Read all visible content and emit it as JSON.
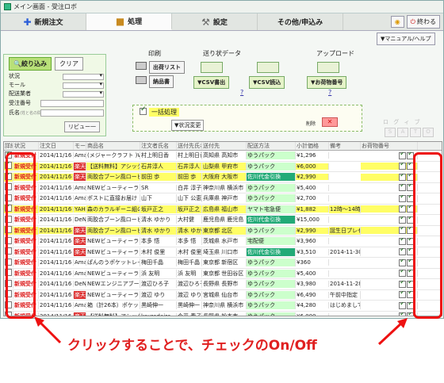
{
  "window": {
    "title": "メイン画面 - 受注ロボ"
  },
  "tabs": [
    {
      "label": "新規注文",
      "icon": "plus-icon"
    },
    {
      "label": "処理",
      "icon": "folder-icon"
    },
    {
      "label": "設定",
      "icon": "wrench-icon"
    },
    {
      "label": "その他/申込み",
      "icon": ""
    }
  ],
  "header_right": {
    "help_label": "",
    "exit_label": "終わる",
    "manual_label": "▼マニュアル/ヘルプ"
  },
  "filter": {
    "search_label": "絞り込み",
    "clear_label": "クリア",
    "fields": [
      "状況",
      "モール",
      "配送業者",
      "受注番号",
      "氏名"
    ],
    "name_hint": "(姓と名の間は空白)",
    "review_label": "リビュー一"
  },
  "sections": {
    "print": {
      "title": "印刷",
      "b1": "出荷リスト",
      "b2": "納品書"
    },
    "send": {
      "title": "送り状データ",
      "b1": "▼CSV書出",
      "b2": "▼CSV読込",
      "help": "?"
    },
    "upload": {
      "title": "アップロード",
      "b1": "▼お荷物番号",
      "help": "?"
    }
  },
  "bulk": {
    "label": "一括処理",
    "action": "▼状況変更",
    "delete": "削除"
  },
  "legend": {
    "text": "ロ グ ィ ブ",
    "boxes": [
      "S",
      "A",
      "T",
      "O"
    ]
  },
  "grid": {
    "headers": [
      "詳細",
      "状況",
      "注文日",
      "モール",
      "商品名",
      "注文者氏名",
      "送付先氏名",
      "送付先",
      "配送方法",
      "小計価格",
      "備考",
      "お荷物番号"
    ],
    "rows": [
      {
        "checked": true,
        "status": "新規受付",
        "date": "2014/11/16",
        "mall": "Ama",
        "product": "(メジャークラフト )WA",
        "orderer": "村上明日香",
        "recipient": "村上明日香",
        "dest": "高知県 高知市",
        "ship": "ゆうパック",
        "price": "¥1,296",
        "memo": "",
        "yellow": false,
        "mall_red": false,
        "ship_green": false
      },
      {
        "checked": true,
        "status": "新規受付",
        "date": "2014/11/16",
        "mall": "楽天",
        "product": "【送料無料】アシックス",
        "orderer": "石井淳人",
        "recipient": "石井淳人",
        "dest": "山梨県 甲府市",
        "ship": "ゆうパック",
        "price": "¥6,000",
        "memo": "",
        "yellow": true,
        "mall_red": true,
        "ship_green": false
      },
      {
        "checked": true,
        "status": "新規受付",
        "date": "2014/11/16",
        "mall": "楽天",
        "product": "両胶合ブーン風ローヒ",
        "orderer": "前田 歩",
        "recipient": "前田 歩",
        "dest": "大阪府 大阪市",
        "ship": "佐川代金引換",
        "price": "¥2,990",
        "memo": "",
        "yellow": true,
        "mall_red": true,
        "ship_green": true
      },
      {
        "checked": false,
        "status": "新規受付",
        "date": "2014/11/16",
        "mall": "Ama",
        "product": "NEWビューティーラッシ",
        "orderer": "SR",
        "recipient": "白井 淳子",
        "dest": "神奈川県 横浜市",
        "ship": "ゆうパック",
        "price": "¥5,400",
        "memo": "",
        "yellow": false,
        "mall_red": false,
        "ship_green": false
      },
      {
        "checked": false,
        "status": "新規受付",
        "date": "2014/11/16",
        "mall": "Ama",
        "product": "ポストに直接お届け　ボ",
        "orderer": "山下",
        "recipient": "山下 公恵",
        "dest": "兵庫県 神戸市",
        "ship": "ゆうパック",
        "price": "¥2,700",
        "memo": "",
        "yellow": false,
        "mall_red": false,
        "ship_green": false
      },
      {
        "checked": true,
        "status": "新規受付",
        "date": "2014/11/16",
        "mall": "YAH",
        "product": "森のカラルギーニ組の",
        "orderer": "坂戸正之",
        "recipient": "坂戸正之",
        "dest": "広島県 福山市",
        "ship": "ヤマト宅急便",
        "price": "¥1,882",
        "memo": "12時〜14時",
        "yellow": true,
        "mall_red": false,
        "ship_green": false
      },
      {
        "checked": false,
        "status": "新規受付",
        "date": "2014/11/16",
        "mall": "DeNa",
        "product": "両胶合ブーン風ローヒ",
        "orderer": "清水 ゆかり",
        "recipient": "大村健",
        "dest": "鹿児島県 鹿児島",
        "ship": "佐川代金引換",
        "price": "¥15,000",
        "memo": "",
        "yellow": false,
        "mall_red": false,
        "ship_green": true
      },
      {
        "checked": false,
        "status": "新規受付",
        "date": "2014/11/16",
        "mall": "楽天",
        "product": "両胶合ブーン風ローヒ",
        "orderer": "清水 ゆかり",
        "recipient": "清水 ゆかり",
        "dest": "東京都 北区",
        "ship": "ゆうパック",
        "price": "¥2,990",
        "memo": "誕生日プレゼント用に包装",
        "yellow": true,
        "mall_red": true,
        "ship_green": false
      },
      {
        "checked": false,
        "status": "新規受付",
        "date": "2014/11/16",
        "mall": "楽天",
        "product": "NEWビューティーラッシ",
        "orderer": "本多 悟",
        "recipient": "本多 悟",
        "dest": "茨城県 水戸市",
        "ship": "宅配便",
        "price": "¥3,960",
        "memo": "",
        "yellow": false,
        "mall_red": true,
        "ship_green": false
      },
      {
        "checked": false,
        "status": "新規受付",
        "date": "2014/11/16",
        "mall": "楽天",
        "product": "NEWビューティーラッシ",
        "orderer": "木村 俊里",
        "recipient": "木村 俊里",
        "dest": "埼玉県 川口市",
        "ship": "佐川代金引換",
        "price": "¥3,510",
        "memo": "2014-11-30(日)指定です",
        "yellow": false,
        "mall_red": true,
        "ship_green": true
      },
      {
        "checked": false,
        "status": "新規受付",
        "date": "2014/11/16",
        "mall": "Ama",
        "product": "ぱんのうポケットレインこ",
        "orderer": "梅田千晶",
        "recipient": "梅田千晶",
        "dest": "東京都 新宿区",
        "ship": "ゆうパック",
        "price": "¥360",
        "memo": "",
        "yellow": false,
        "mall_red": false,
        "ship_green": false
      },
      {
        "checked": false,
        "status": "新規受付",
        "date": "2014/11/16",
        "mall": "Ama",
        "product": "NEWビューティーラッシ",
        "orderer": "浜 友明",
        "recipient": "浜 友明",
        "dest": "東京都 世田谷区",
        "ship": "ゆうパック",
        "price": "¥5,400",
        "memo": "",
        "yellow": false,
        "mall_red": false,
        "ship_green": false
      },
      {
        "checked": false,
        "status": "新規受付",
        "date": "2014/11/16",
        "mall": "DeNa",
        "product": "NEWエンジニアブーン",
        "orderer": "渡辺ひろ子",
        "recipient": "渡辺ひろ子",
        "dest": "長野県 長野市",
        "ship": "ゆうパック",
        "price": "¥3,980",
        "memo": "2014-11-28(金)",
        "yellow": false,
        "mall_red": false,
        "ship_green": false
      },
      {
        "checked": false,
        "status": "新規受付",
        "date": "2014/11/16",
        "mall": "楽天",
        "product": "NEWビューティーラッシ",
        "orderer": "渡辺 ゆり",
        "recipient": "渡辺 ゆり",
        "dest": "宮城県 仙台市",
        "ship": "ゆうパック",
        "price": "¥6,490",
        "memo": "午前中指定",
        "yellow": false,
        "mall_red": true,
        "ship_green": false
      },
      {
        "checked": false,
        "status": "新規受付",
        "date": "2014/11/16",
        "mall": "Ama",
        "product": "箱（計26本）ポケット",
        "orderer": "黒崎伸一",
        "recipient": "黒崎伸一",
        "dest": "神奈川県 横浜市",
        "ship": "ゆうパック",
        "price": "¥4,280",
        "memo": "はじめまして初めて購入します",
        "yellow": false,
        "mall_red": false,
        "ship_green": false
      },
      {
        "checked": false,
        "status": "新規受付",
        "date": "2014/11/16",
        "mall": "楽天",
        "product": "【送料無料】アシックス",
        "orderer": "kayradaira",
        "recipient": "今平 春子",
        "dest": "長野県 松本市",
        "ship": "ゆうパック",
        "price": "¥6,000",
        "memo": "",
        "yellow": false,
        "mall_red": true,
        "ship_green": false
      },
      {
        "checked": false,
        "status": "新規受付",
        "date": "2014/11/16",
        "mall": "Ama",
        "product": "ポケットレインコート(3",
        "orderer": "斉藤 一正",
        "recipient": "斉藤 一正",
        "dest": "大阪府 堺市",
        "ship": "ゆうパック",
        "price": "¥1,296",
        "memo": "",
        "yellow": false,
        "mall_red": false,
        "ship_green": false
      }
    ]
  },
  "caption": "クリックすることで、チェックのOn/Off",
  "colors": {
    "highlight": "#e11111",
    "row_yellow": "#fffe66",
    "accent_green": "#b8e078"
  }
}
